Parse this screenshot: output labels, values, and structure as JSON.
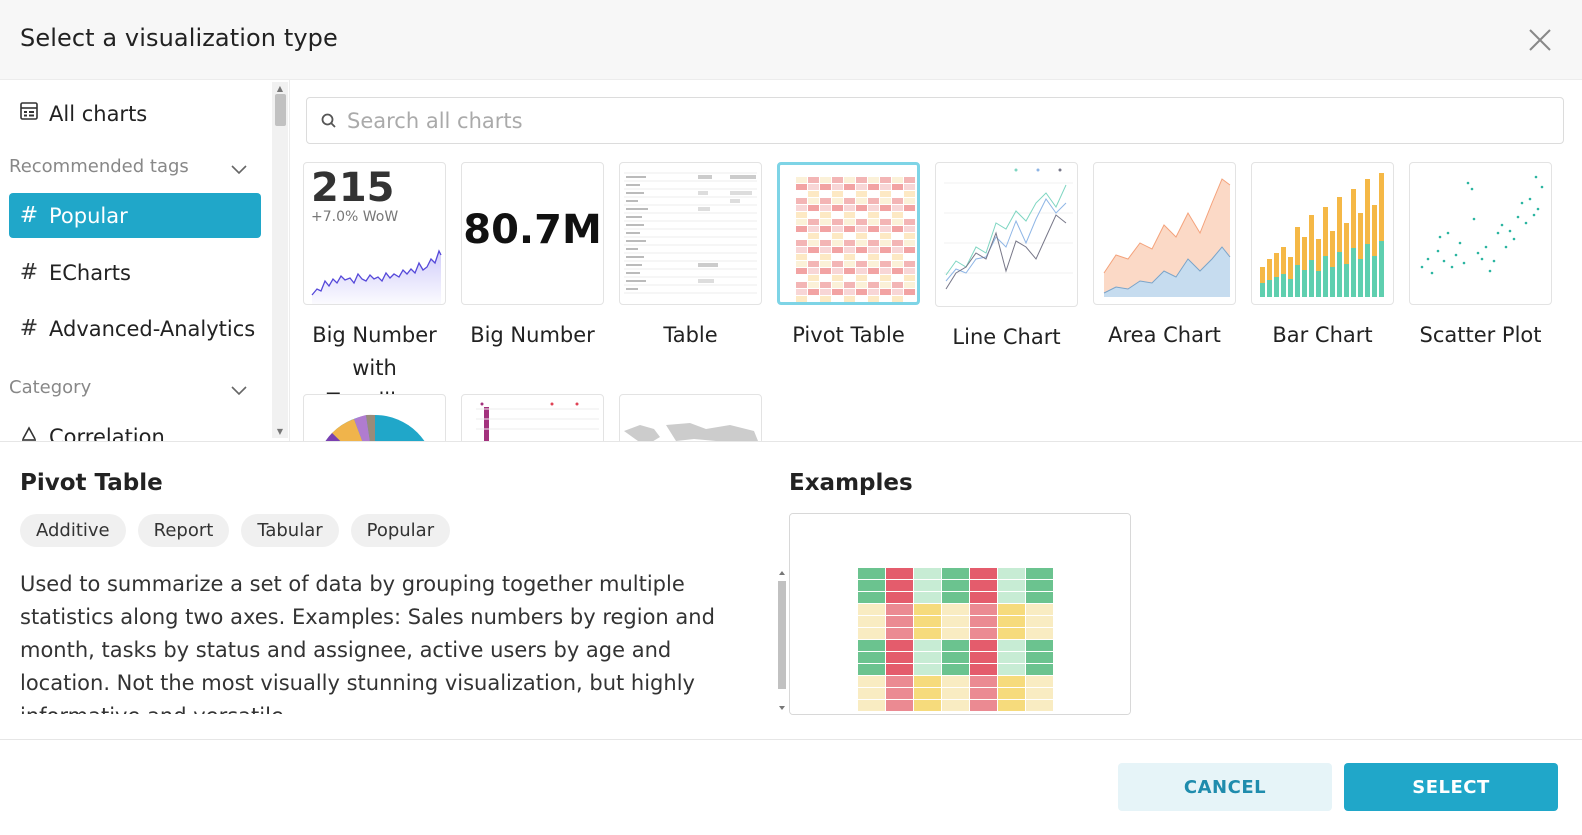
{
  "header": {
    "title": "Select a visualization type"
  },
  "sidebar": {
    "all_charts": "All charts",
    "recommended_tags": "Recommended tags",
    "tags": [
      "Popular",
      "ECharts",
      "Advanced-Analytics"
    ],
    "category": "Category",
    "category_first": "Correlation"
  },
  "search": {
    "placeholder": "Search all charts",
    "value": ""
  },
  "charts": [
    {
      "label": "Big Number with Trendline",
      "big_value": "215",
      "sub_value": "+7.0% WoW"
    },
    {
      "label": "Big Number",
      "big_value": "80.7M"
    },
    {
      "label": "Table"
    },
    {
      "label": "Pivot Table"
    },
    {
      "label": "Line Chart"
    },
    {
      "label": "Area Chart"
    },
    {
      "label": "Bar Chart"
    },
    {
      "label": "Scatter Plot"
    }
  ],
  "selected_chart": "Pivot Table",
  "detail": {
    "title": "Pivot Table",
    "tags": [
      "Additive",
      "Report",
      "Tabular",
      "Popular"
    ],
    "description": "Used to summarize a set of data by grouping together multiple statistics along two axes. Examples: Sales numbers by region and month, tasks by status and assignee, active users by age and location. Not the most visually stunning visualization, but highly informative and versatile.",
    "examples_title": "Examples"
  },
  "footer": {
    "cancel": "CANCEL",
    "select": "SELECT"
  },
  "colors": {
    "accent": "#20a7c9",
    "cancel_bg": "#e6f4f8",
    "selected_border": "#7ed4e6"
  }
}
